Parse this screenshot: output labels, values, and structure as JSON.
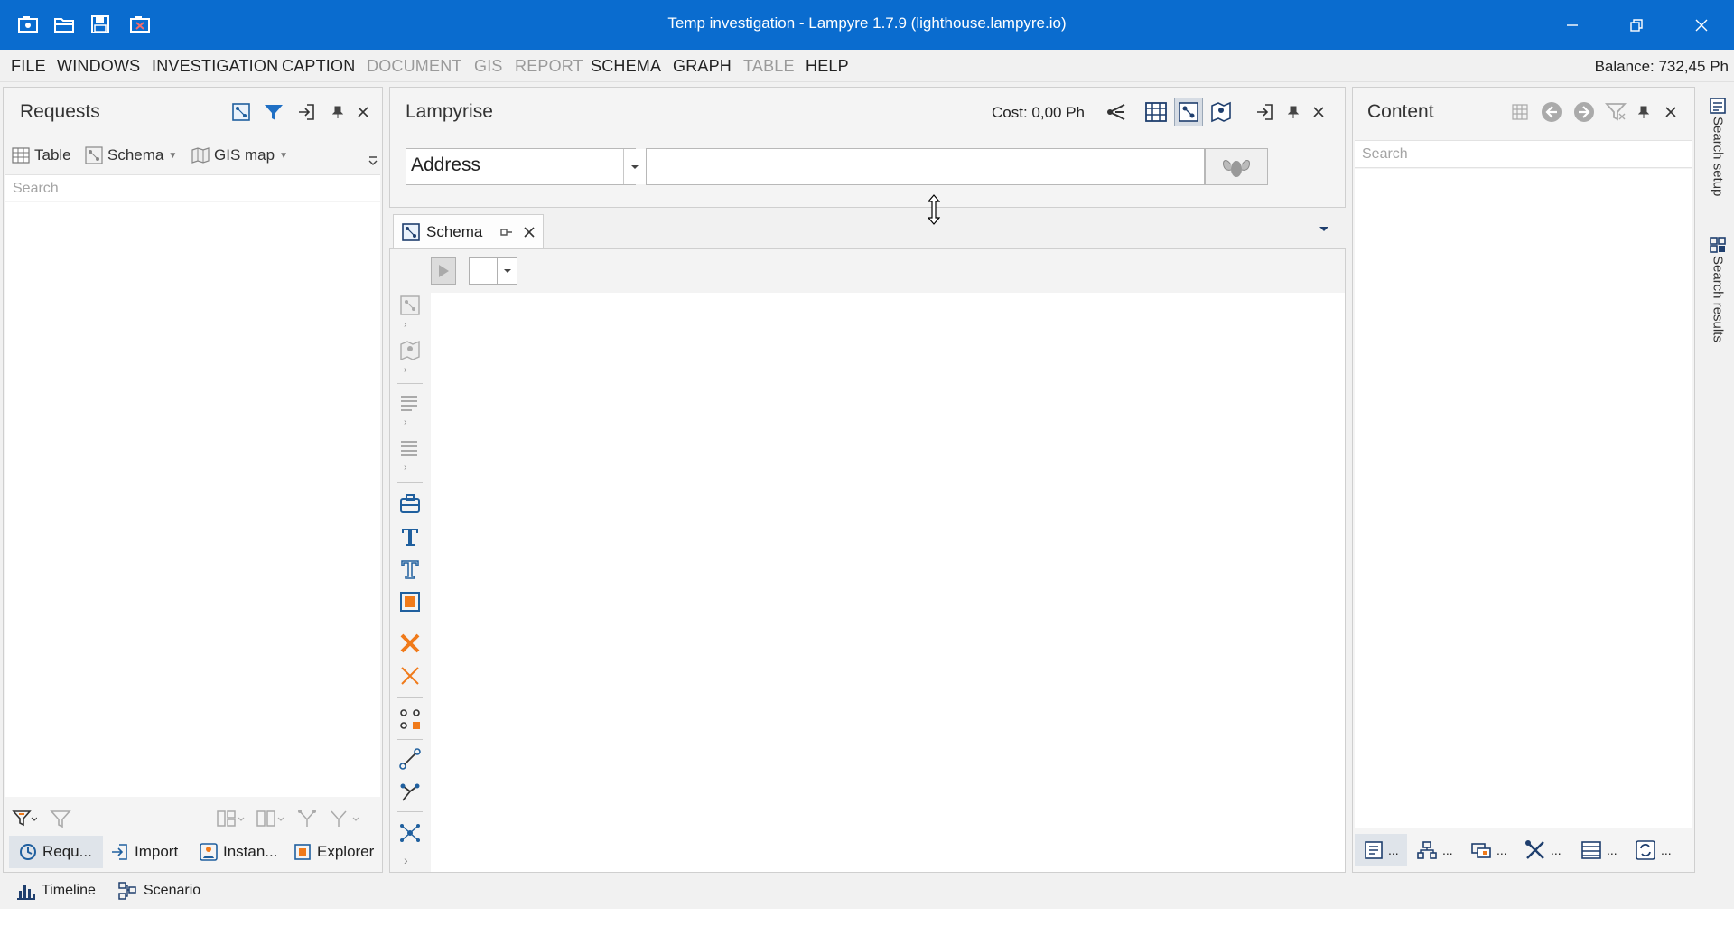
{
  "window": {
    "title": "Temp investigation - Lampyre 1.7.9 (lighthouse.lampyre.io)",
    "quick_access": [
      "new-investigation-icon",
      "open-folder-icon",
      "save-icon",
      "close-investigation-icon"
    ],
    "controls": [
      "minimize-icon",
      "restore-icon",
      "close-icon"
    ]
  },
  "menu": {
    "items": [
      {
        "label": "FILE",
        "enabled": true
      },
      {
        "label": "WINDOWS",
        "enabled": true
      },
      {
        "label": "INVESTIGATION",
        "enabled": true
      },
      {
        "label": "CAPTION",
        "enabled": true
      },
      {
        "label": "DOCUMENT",
        "enabled": false
      },
      {
        "label": "GIS",
        "enabled": false
      },
      {
        "label": "REPORT",
        "enabled": false
      },
      {
        "label": "SCHEMA",
        "enabled": true
      },
      {
        "label": "GRAPH",
        "enabled": true
      },
      {
        "label": "TABLE",
        "enabled": false
      },
      {
        "label": "HELP",
        "enabled": true
      }
    ],
    "balance": "Balance: 732,45 Ph"
  },
  "requests": {
    "title": "Requests",
    "tabs": [
      {
        "label": "Table"
      },
      {
        "label": "Schema"
      },
      {
        "label": "GIS map"
      }
    ],
    "search_placeholder": "Search",
    "bottom_tabs": [
      {
        "label": "Requ...",
        "active": true
      },
      {
        "label": "Import",
        "active": false
      },
      {
        "label": "Instan...",
        "active": false
      },
      {
        "label": "Explorer",
        "active": false
      }
    ]
  },
  "lampyrise": {
    "title": "Lampyrise",
    "cost": "Cost: 0,00 Ph",
    "search_type": "Address",
    "search_value": ""
  },
  "schema_doc": {
    "tab_label": "Schema"
  },
  "content": {
    "title": "Content",
    "search_placeholder": "Search",
    "bottom_ellipsis": "..."
  },
  "side_strip": {
    "items": [
      "Search setup",
      "Search results"
    ]
  },
  "status": {
    "items": [
      "Timeline",
      "Scenario"
    ]
  },
  "colors": {
    "titlebar": "#0a6ccf",
    "accent_orange": "#f07a1a",
    "icon_blue": "#1f5f9e",
    "icon_gray": "#9a9a9a"
  }
}
